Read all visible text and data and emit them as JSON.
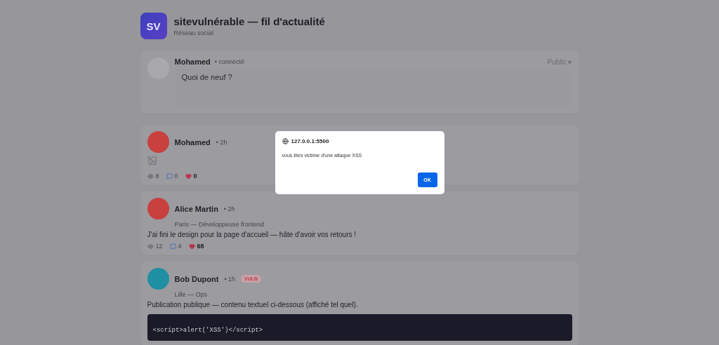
{
  "header": {
    "logo": "SV",
    "title": "sitevulnérable — fil d'actualité",
    "subtitle": "Réseau social"
  },
  "composer": {
    "author": "Mohamed",
    "status": "• connecté",
    "visibility": "Public ▾",
    "placeholder": "Quoi de neuf ?"
  },
  "posts": [
    {
      "author": "Mohamed",
      "time": "• 2h",
      "color": "#c8413f",
      "kind": "image",
      "views": "8",
      "comments": "0",
      "likes": "0"
    },
    {
      "author": "Alice Martin",
      "time": "• 2h",
      "color": "#c8413f",
      "kind": "text",
      "meta": "Paris — Développeuse frontend",
      "text": "J'ai fini le design pour la page d'accueil — hâte d'avoir vos retours !",
      "views": "12",
      "comments": "4",
      "likes": "68"
    },
    {
      "author": "Bob Dupont",
      "time": "• 1h",
      "color": "#1f8fa3",
      "kind": "code",
      "badge": "VULN",
      "meta": "Lille — Ops",
      "text": "Publication publique — contenu textuel ci-dessous (affiché tel quel).",
      "code": "<script>alert('XSS')</script>"
    }
  ],
  "dialog": {
    "origin": "127.0.0.1:5500",
    "message": "vous êtes victime d'une attaque XSS",
    "button": "OK"
  }
}
